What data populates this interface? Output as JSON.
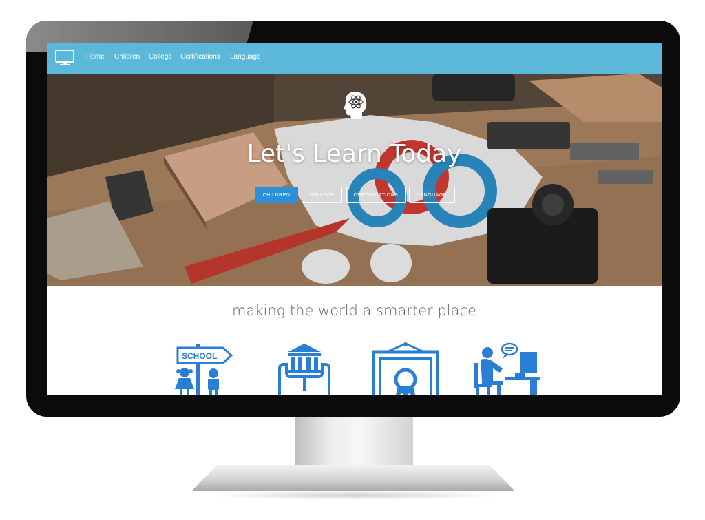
{
  "nav": {
    "logo_icon": "monitor-icon",
    "links": [
      "Home",
      "Children",
      "College",
      "Certifications",
      "Language"
    ]
  },
  "hero": {
    "icon": "brain-atom-icon",
    "title": "Let's Learn Today",
    "buttons": [
      "CHILDREN",
      "COLLEGE",
      "CERTIFICATIONS",
      "LANGUAGE"
    ]
  },
  "tagline": "making the world a smarter place",
  "features": {
    "school_sign": "SCHOOL",
    "icons": [
      "children-school-icon",
      "college-building-icon",
      "certificate-icon",
      "language-learner-icon"
    ]
  },
  "colors": {
    "nav_bg": "#5bb8d8",
    "accent_blue": "#2b90d9",
    "icon_blue": "#2a7fd4"
  }
}
